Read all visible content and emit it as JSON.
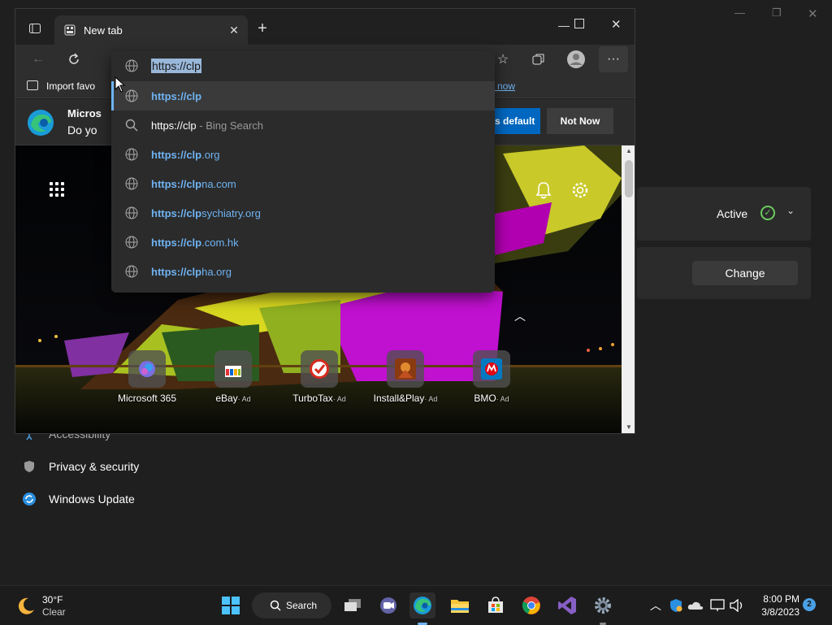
{
  "desktop": {
    "settings": {
      "status": "Active",
      "change_button": "Change",
      "nav": {
        "accessibility": "Accessibility",
        "privacy": "Privacy & security",
        "update": "Windows Update"
      }
    }
  },
  "browser": {
    "tab_title": "New tab",
    "address_value": "https://clp",
    "favorites_bar": {
      "import": "Import favo",
      "link_tail": "es now"
    },
    "infobar": {
      "title_partial": "Micros",
      "body_partial": "Do yo",
      "set_default_partial": "t as default",
      "not_now": "Not Now"
    },
    "suggestions": [
      {
        "icon": "globe-icon",
        "bold": "https://clp",
        "rest": "",
        "suffix": ""
      },
      {
        "icon": "search-icon",
        "bold": "",
        "rest": "https://clp",
        "suffix": " - Bing Search"
      },
      {
        "icon": "globe-icon",
        "bold": "https://clp",
        "rest": ".org",
        "suffix": ""
      },
      {
        "icon": "globe-icon",
        "bold": "https://clp",
        "rest": "na.com",
        "suffix": ""
      },
      {
        "icon": "globe-icon",
        "bold": "https://clp",
        "rest": "sychiatry.org",
        "suffix": ""
      },
      {
        "icon": "globe-icon",
        "bold": "https://clp",
        "rest": ".com.hk",
        "suffix": ""
      },
      {
        "icon": "globe-icon",
        "bold": "https://clp",
        "rest": "ha.org",
        "suffix": ""
      }
    ],
    "quick_links": [
      {
        "label": "Microsoft 365",
        "ad": ""
      },
      {
        "label": "eBay",
        "ad": "· Ad"
      },
      {
        "label": "TurboTax",
        "ad": "· Ad"
      },
      {
        "label": "Install&Play",
        "ad": "· Ad"
      },
      {
        "label": "BMO",
        "ad": "· Ad"
      }
    ]
  },
  "taskbar": {
    "weather_temp": "30°F",
    "weather_desc": "Clear",
    "search_label": "Search",
    "time": "8:00 PM",
    "date": "3/8/2023",
    "notification_count": "2"
  },
  "colors": {
    "accent": "#0067c0",
    "link": "#6fb3f2",
    "active_check": "#6ccb5f"
  }
}
